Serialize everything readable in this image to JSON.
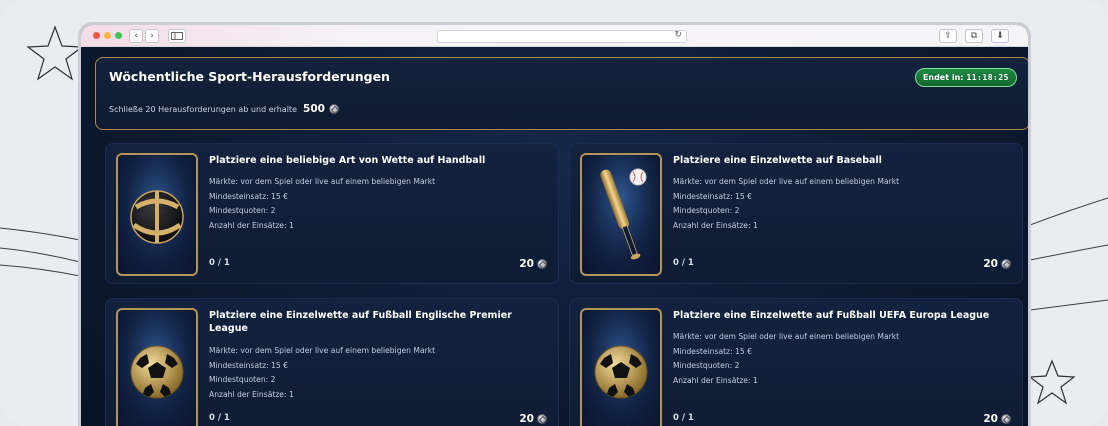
{
  "browser": {
    "nav_back": "‹",
    "nav_forward": "›",
    "sidebar_icon": "sidebar-icon",
    "reload_icon": "↻",
    "share_icon": "⇪",
    "tabs_icon": "⧉",
    "download_icon": "⬇"
  },
  "challenge": {
    "title": "Wöchentliche Sport-Herausforderungen",
    "subtitle": "Schließe 20 Herausforderungen ab und erhalte",
    "reward_total": "500",
    "timer_label": "Endet in:",
    "timer_value": "11:18:25"
  },
  "cards": [
    {
      "title": "Platziere eine beliebige Art von Wette auf Handball",
      "details": [
        "Märkte: vor dem Spiel oder live auf einem beliebigen Markt",
        "Mindesteinsatz: 15 €",
        "Mindestquoten: 2",
        "Anzahl der Einsätze: 1"
      ],
      "progress": "0 / 1",
      "reward": "20",
      "icon": "handball-icon"
    },
    {
      "title": "Platziere eine Einzelwette auf Baseball",
      "details": [
        "Märkte: vor dem Spiel oder live auf einem beliebigen Markt",
        "Mindesteinsatz: 15 €",
        "Mindestquoten: 2",
        "Anzahl der Einsätze: 1"
      ],
      "progress": "0 / 1",
      "reward": "20",
      "icon": "baseball-icon"
    },
    {
      "title": "Platziere eine Einzelwette auf Fußball Englische Premier League",
      "details": [
        "Märkte: vor dem Spiel oder live auf einem beliebigen Markt",
        "Mindesteinsatz: 15 €",
        "Mindestquoten: 2",
        "Anzahl der Einsätze: 1"
      ],
      "progress": "0 / 1",
      "reward": "20",
      "icon": "soccer-ball-icon"
    },
    {
      "title": "Platziere eine Einzelwette auf Fußball UEFA Europa League",
      "details": [
        "Märkte: vor dem Spiel oder live auf einem beliebigen Markt",
        "Mindesteinsatz: 15 €",
        "Mindestquoten: 2",
        "Anzahl der Einsätze: 1"
      ],
      "progress": "0 / 1",
      "reward": "20",
      "icon": "soccer-ball-icon"
    }
  ],
  "colors": {
    "accent_gold": "#b39356",
    "timer_green": "#1f8a43",
    "background_navy": "#0c1a31"
  }
}
